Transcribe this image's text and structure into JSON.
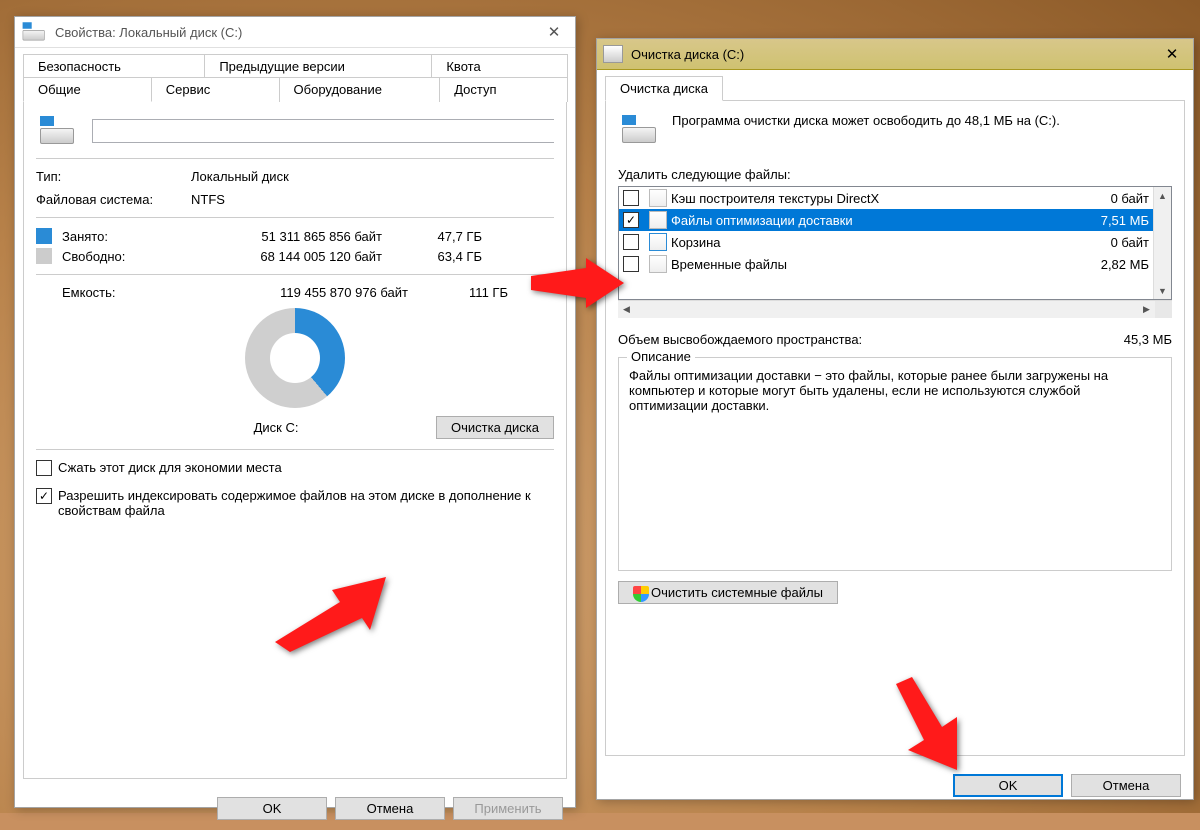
{
  "props": {
    "title": "Свойства: Локальный диск (C:)",
    "tabs_row1": [
      "Безопасность",
      "Предыдущие версии",
      "Квота"
    ],
    "tabs_row2": [
      "Общие",
      "Сервис",
      "Оборудование",
      "Доступ"
    ],
    "active_tab": "Общие",
    "type_label": "Тип:",
    "type_value": "Локальный диск",
    "fs_label": "Файловая система:",
    "fs_value": "NTFS",
    "used_label": "Занято:",
    "used_bytes": "51 311 865 856 байт",
    "used_gb": "47,7 ГБ",
    "free_label": "Свободно:",
    "free_bytes": "68 144 005 120 байт",
    "free_gb": "63,4 ГБ",
    "cap_label": "Емкость:",
    "cap_bytes": "119 455 870 976 байт",
    "cap_gb": "111 ГБ",
    "disk_label": "Диск C:",
    "cleanup_btn": "Очистка диска",
    "compress_label": "Сжать этот диск для экономии места",
    "index_label": "Разрешить индексировать содержимое файлов на этом диске в дополнение к свойствам файла",
    "ok": "OK",
    "cancel": "Отмена",
    "apply": "Применить"
  },
  "clean": {
    "title": "Очистка диска  (C:)",
    "tab": "Очистка диска",
    "intro": "Программа очистки диска может освободить до 48,1 МБ на  (C:).",
    "files_label": "Удалить следующие файлы:",
    "items": [
      {
        "checked": false,
        "name": "Кэш построителя текстуры DirectX",
        "size": "0 байт",
        "sel": false
      },
      {
        "checked": true,
        "name": "Файлы оптимизации доставки",
        "size": "7,51 МБ",
        "sel": true
      },
      {
        "checked": false,
        "name": "Корзина",
        "size": "0 байт",
        "sel": false,
        "recycle": true
      },
      {
        "checked": false,
        "name": "Временные файлы",
        "size": "2,82 МБ",
        "sel": false
      }
    ],
    "gain_label": "Объем высвобождаемого пространства:",
    "gain_value": "45,3 МБ",
    "desc_title": "Описание",
    "desc_text": "Файлы оптимизации доставки − это файлы, которые ранее были загружены на компьютер и которые могут быть удалены, если не используются службой оптимизации доставки.",
    "sysfiles_btn": "Очистить системные файлы",
    "ok": "OK",
    "cancel": "Отмена"
  }
}
